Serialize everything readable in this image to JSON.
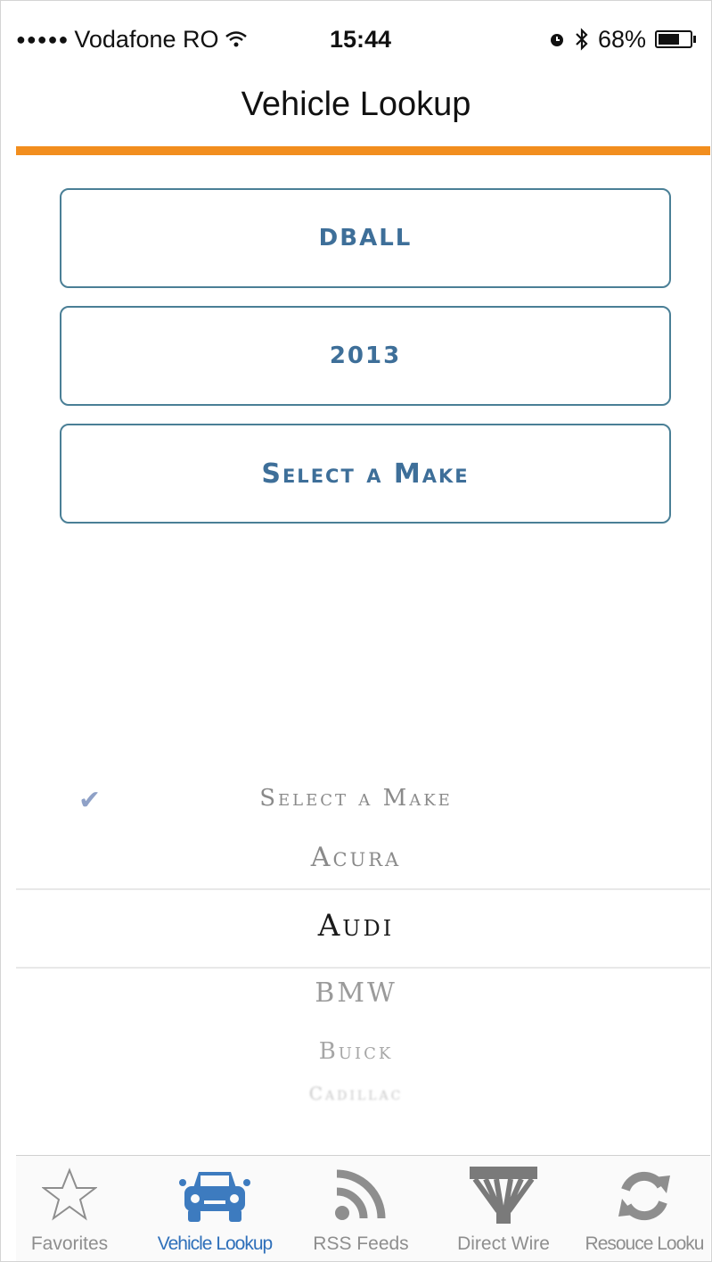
{
  "status_bar": {
    "signal": "●●●●●",
    "carrier": "Vodafone RO",
    "time": "15:44",
    "battery": "68%",
    "battery_level": 0.68
  },
  "nav": {
    "title": "Vehicle Lookup"
  },
  "fields": {
    "name": "DBALL",
    "year": "2013",
    "make": "Select a Make"
  },
  "picker": {
    "items": [
      "Select a Make",
      "Acura",
      "Audi",
      "BMW",
      "Buick",
      "Cadillac"
    ],
    "selected": "Audi"
  },
  "tabs": [
    {
      "label": "Favorites",
      "icon": "star-icon"
    },
    {
      "label": "Vehicle Lookup",
      "icon": "car-icon"
    },
    {
      "label": "RSS Feeds",
      "icon": "rss-icon"
    },
    {
      "label": "Direct Wire",
      "icon": "wire-icon"
    },
    {
      "label": "Resouce Looku",
      "icon": "refresh-icon"
    }
  ],
  "colors": {
    "accent": "#f28e1e",
    "button_text": "#3e6f99",
    "tab_active": "#2f70ba"
  }
}
